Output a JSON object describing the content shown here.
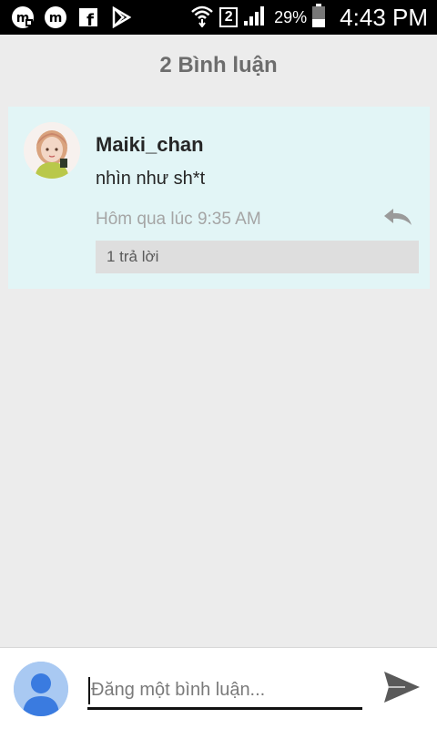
{
  "status_bar": {
    "sim_slot": "2",
    "battery_percent": "29%",
    "time": "4:43 PM",
    "icons": [
      "messenger-icon",
      "m-app-icon",
      "facebook-icon",
      "play-store-icon",
      "wifi-icon",
      "signal-icon",
      "battery-icon"
    ]
  },
  "header": {
    "title": "2 Bình luận"
  },
  "comment": {
    "author": "Maiki_chan",
    "text": "nhìn như sh*t",
    "timestamp": "Hôm qua lúc 9:35 AM",
    "replies_label": "1 trả lời"
  },
  "composer": {
    "placeholder": "Đăng một bình luận..."
  },
  "colors": {
    "card_background": "#e2f5f6",
    "page_background": "#ececec",
    "avatar_blue": "#3a7be0",
    "send_icon": "#5a5a5a"
  }
}
